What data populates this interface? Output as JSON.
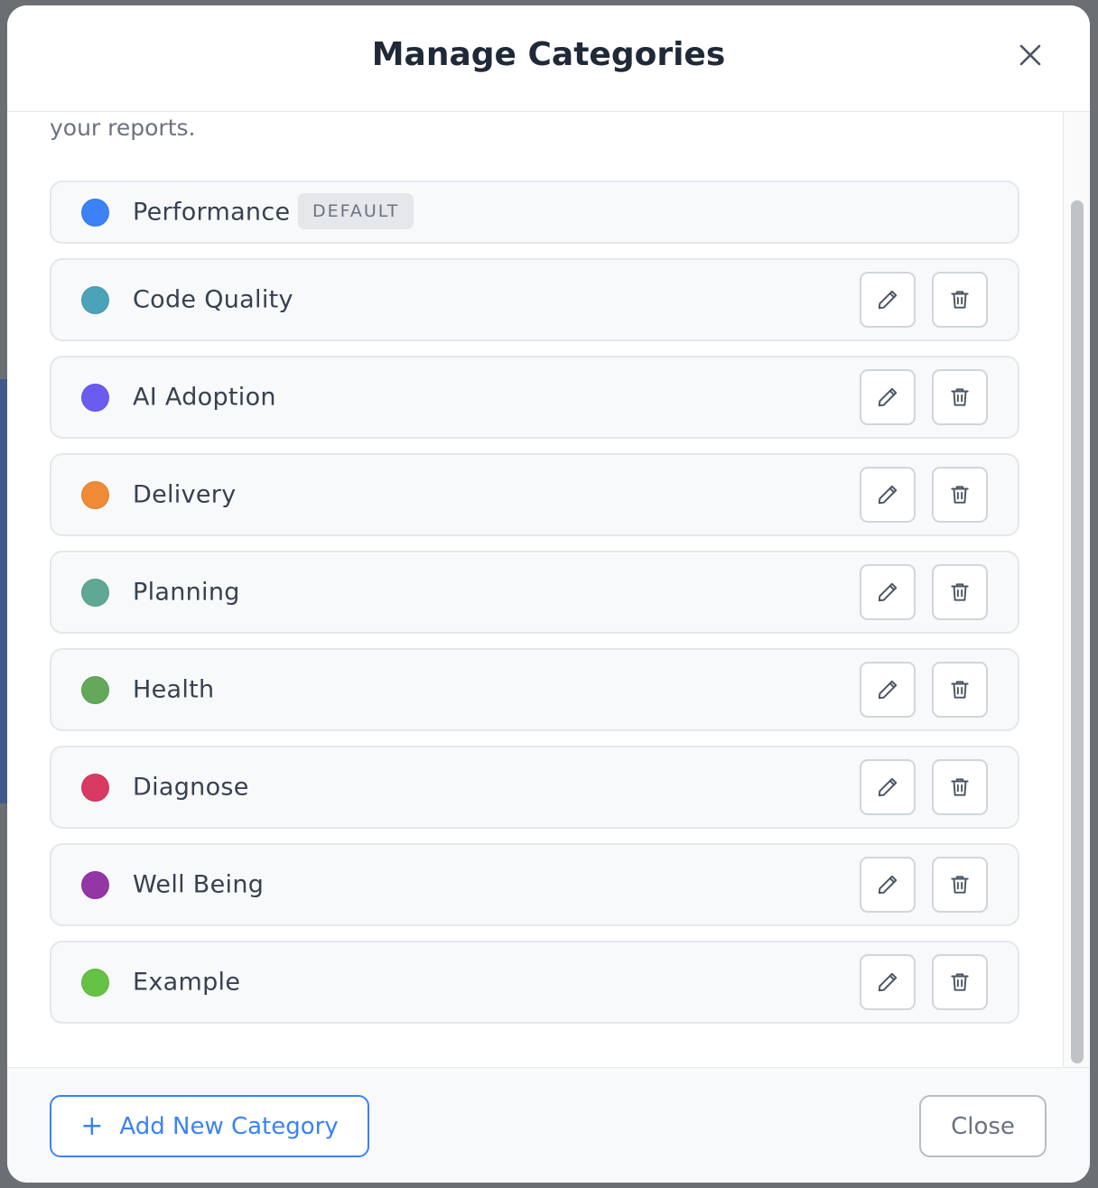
{
  "modal": {
    "title": "Manage Categories",
    "intro_text": "your reports."
  },
  "categories": [
    {
      "name": "Performance",
      "color": "#3b82f6",
      "badge": "DEFAULT",
      "is_default": true
    },
    {
      "name": "Code Quality",
      "color": "#4aa3b8",
      "is_default": false
    },
    {
      "name": "AI Adoption",
      "color": "#6a5cf0",
      "is_default": false
    },
    {
      "name": "Delivery",
      "color": "#f08a34",
      "is_default": false
    },
    {
      "name": "Planning",
      "color": "#5fa895",
      "is_default": false
    },
    {
      "name": "Health",
      "color": "#64a85a",
      "is_default": false
    },
    {
      "name": "Diagnose",
      "color": "#d93a63",
      "is_default": false
    },
    {
      "name": "Well Being",
      "color": "#9436a6",
      "is_default": false
    },
    {
      "name": "Example",
      "color": "#66c244",
      "is_default": false
    }
  ],
  "footer": {
    "add_label": "Add New Category",
    "close_label": "Close"
  },
  "icons": {
    "close": "close-icon",
    "edit": "pencil-icon",
    "delete": "trash-icon",
    "add": "plus-icon"
  },
  "theme": {
    "accent": "#3b82f6"
  }
}
